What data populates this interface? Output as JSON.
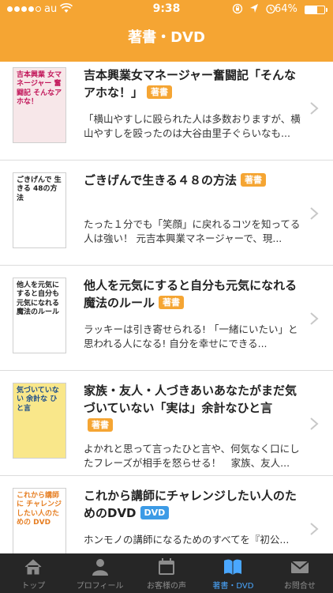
{
  "status_bar": {
    "carrier": "au",
    "time": "9:38",
    "battery": "64%",
    "battery_level": 0.64,
    "signal_bars": 4
  },
  "nav": {
    "title": "著書・DVD"
  },
  "items": [
    {
      "title": "吉本興業女マネージャー奮闘記「そんなアホな！」",
      "badge": "著書",
      "badge_type": "book",
      "desc": "「横山やすしに殴られた人は多数おりますが、横山やすしを殴ったのは大谷由里子ぐらいなも...",
      "cover_text": "吉本興業 女マネージャー 奮闘記 そんなアホな！",
      "cover_icon": "book-cover-icon"
    },
    {
      "title": "ごきげんで生きる４８の方法",
      "badge": "著書",
      "badge_type": "book",
      "desc": "たった１分でも「笑顔」に戻れるコツを知ってる人は強い！ 元吉本興業マネージャーで、現...",
      "cover_text": "ごきげんで 生きる 48の方法",
      "cover_icon": "book-cover-icon"
    },
    {
      "title": "他人を元気にすると自分も元気になれる魔法のルール",
      "badge": "著書",
      "badge_type": "book",
      "desc": "ラッキーは引き寄せられる! 「一緒にいたい」と思われる人になる! 自分を幸せにできる...",
      "cover_text": "他人を元気にすると自分も元気になれる魔法のルール",
      "cover_icon": "book-cover-icon"
    },
    {
      "title": "家族・友人・人づきあいあなたがまだ気づいていない「実は」余計なひと言",
      "badge": "著書",
      "badge_type": "book",
      "desc": "よかれと思って言ったひと言や、何気なく口にしたフレーズが相手を怒らせる！　家族、友人...",
      "cover_text": "気づいていない 余計な ひと言",
      "cover_icon": "book-cover-icon"
    },
    {
      "title": "これから講師にチャレンジしたい人のためのDVD",
      "badge": "DVD",
      "badge_type": "dvd",
      "desc": "ホンモノの講師になるためのすべてを『初公...",
      "cover_text": "これから講師に チャレンジしたい人のための DVD",
      "cover_icon": "dvd-cover-icon"
    }
  ],
  "tabs": [
    {
      "label": "トップ",
      "icon": "home-icon",
      "active": false
    },
    {
      "label": "プロフィール",
      "icon": "person-icon",
      "active": false
    },
    {
      "label": "お客様の声",
      "icon": "calendar-icon",
      "active": false
    },
    {
      "label": "著書・DVD",
      "icon": "book-icon",
      "active": true
    },
    {
      "label": "お問合せ",
      "icon": "mail-icon",
      "active": false
    }
  ],
  "colors": {
    "accent": "#f5a533",
    "dvd_badge": "#3c9be6",
    "tab_active": "#4aa7ff",
    "tab_bar": "#262626"
  }
}
